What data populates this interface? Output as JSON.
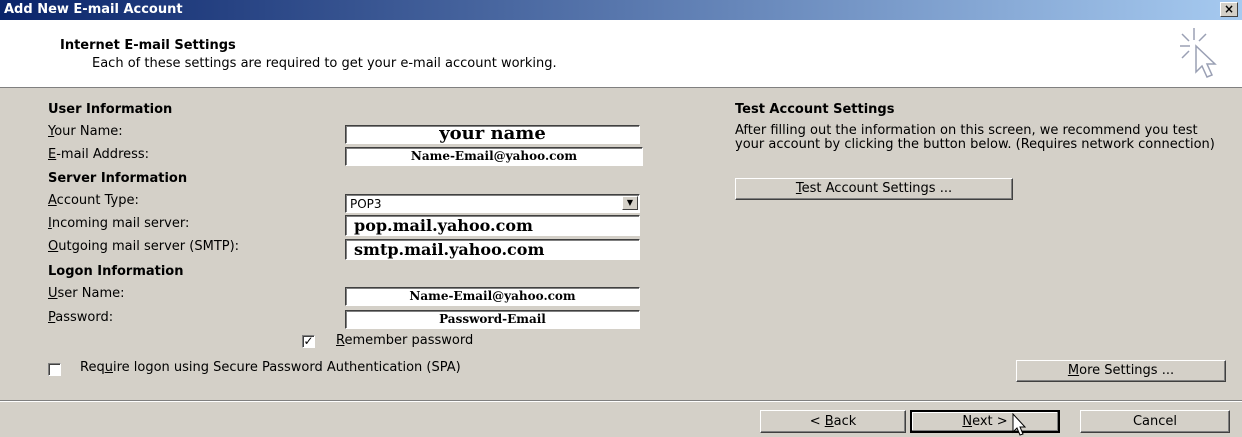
{
  "window": {
    "title": "Add New E-mail Account",
    "close_label": "×"
  },
  "header": {
    "title": "Internet E-mail Settings",
    "subtitle": "Each of these settings are required to get your e-mail account working."
  },
  "user_info": {
    "heading": "User Information",
    "name_label_key": "Y",
    "name_label_rest": "our Name:",
    "name_value": "your name",
    "email_label_key": "E",
    "email_label_rest": "-mail Address:",
    "email_value": "Name-Email@yahoo.com"
  },
  "server_info": {
    "heading": "Server Information",
    "account_type_label_key": "A",
    "account_type_label_rest": "ccount Type:",
    "account_type_value": "POP3",
    "incoming_label_key": "I",
    "incoming_label_rest": "ncoming mail server:",
    "incoming_value": "pop.mail.yahoo.com",
    "outgoing_label_key": "O",
    "outgoing_label_rest": "utgoing mail server (SMTP):",
    "outgoing_value": "smtp.mail.yahoo.com"
  },
  "logon_info": {
    "heading": "Logon Information",
    "username_label_key": "U",
    "username_label_rest": "ser Name:",
    "username_value": "Name-Email@yahoo.com",
    "password_label_key": "P",
    "password_label_rest": "assword:",
    "password_value": "Password-Email",
    "remember_key": "R",
    "remember_rest": "emember password",
    "remember_checked": true,
    "spa_pre": "Req",
    "spa_key": "u",
    "spa_rest": "ire logon using Secure Password Authentication (SPA)",
    "spa_checked": false
  },
  "test_section": {
    "heading": "Test Account Settings",
    "description": "After filling out the information on this screen, we recommend you test your account by clicking the button below. (Requires network connection)",
    "button_key": "T",
    "button_rest": "est Account Settings ..."
  },
  "buttons": {
    "more_key": "M",
    "more_rest": "ore Settings ...",
    "back_pre": "< ",
    "back_key": "B",
    "back_rest": "ack",
    "next_key": "N",
    "next_rest": "ext >",
    "cancel": "Cancel"
  },
  "icons": {
    "header": "new-account-sparkle-cursor-icon",
    "dropdown": "chevron-down-icon",
    "checkmark": "check-icon",
    "mouse": "mouse-cursor-icon"
  }
}
